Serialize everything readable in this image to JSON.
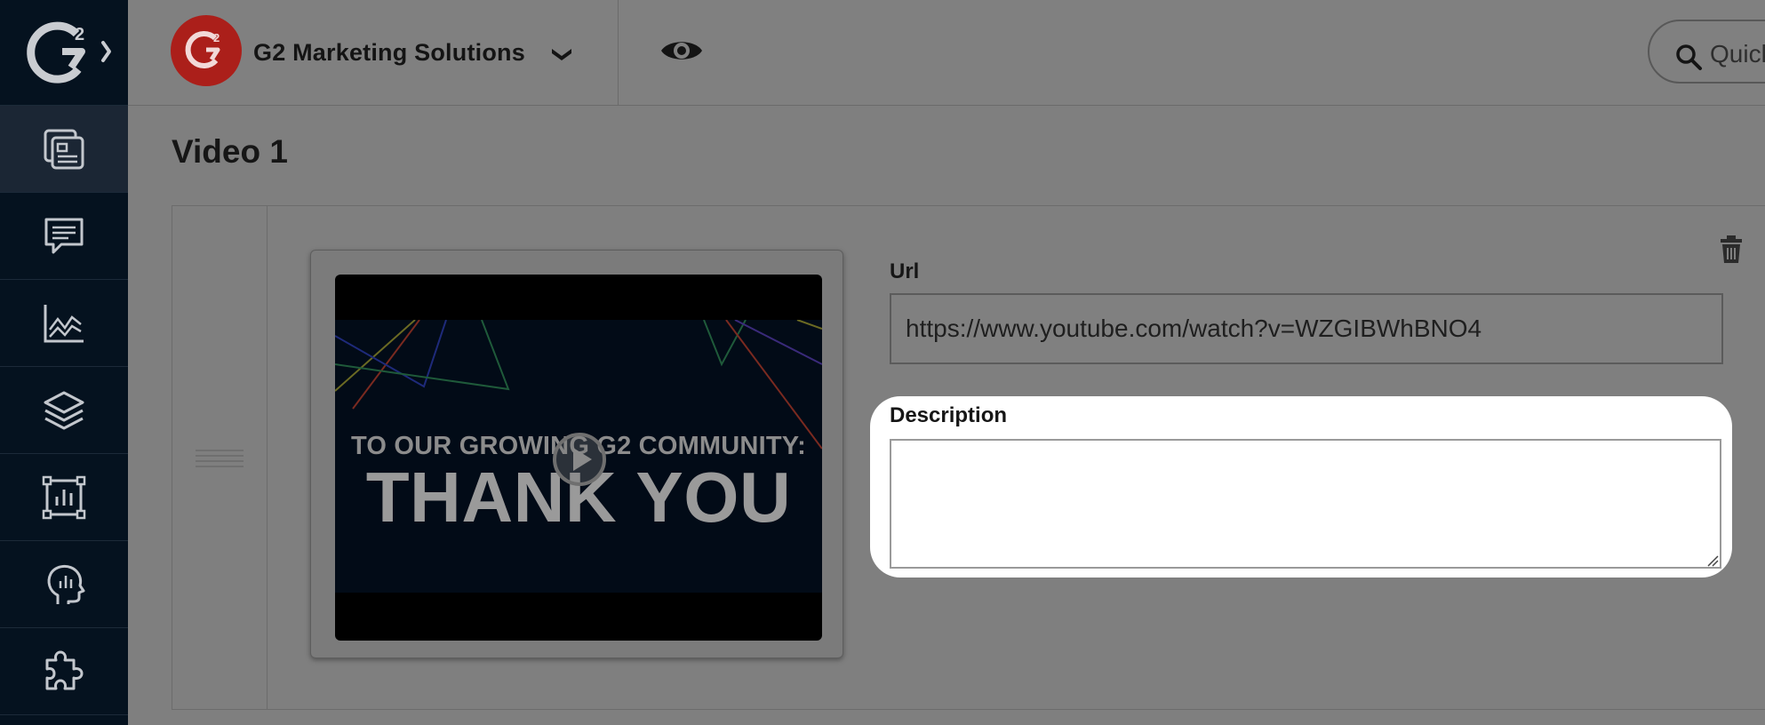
{
  "sidebar": {
    "items": [
      {
        "icon": "content-pages-icon",
        "active": true
      },
      {
        "icon": "chat-bubble-icon"
      },
      {
        "icon": "line-chart-icon"
      },
      {
        "icon": "layers-icon"
      },
      {
        "icon": "bar-chart-frame-icon"
      },
      {
        "icon": "head-insights-icon"
      },
      {
        "icon": "puzzle-icon"
      }
    ]
  },
  "header": {
    "brand_name": "G2 Marketing Solutions",
    "search_placeholder": "Quick"
  },
  "page": {
    "title": "Video 1"
  },
  "video": {
    "thumb_line1": "TO OUR GROWING G2 COMMUNITY:",
    "thumb_line2": "THANK YOU"
  },
  "form": {
    "url_label": "Url",
    "url_value": "https://www.youtube.com/watch?v=WZGIBWhBNO4",
    "description_label": "Description",
    "description_value": ""
  },
  "colors": {
    "sidebar_bg": "#05121f",
    "brand_red": "#ab1f1a",
    "overlay_gray": "#7f7f7f"
  }
}
